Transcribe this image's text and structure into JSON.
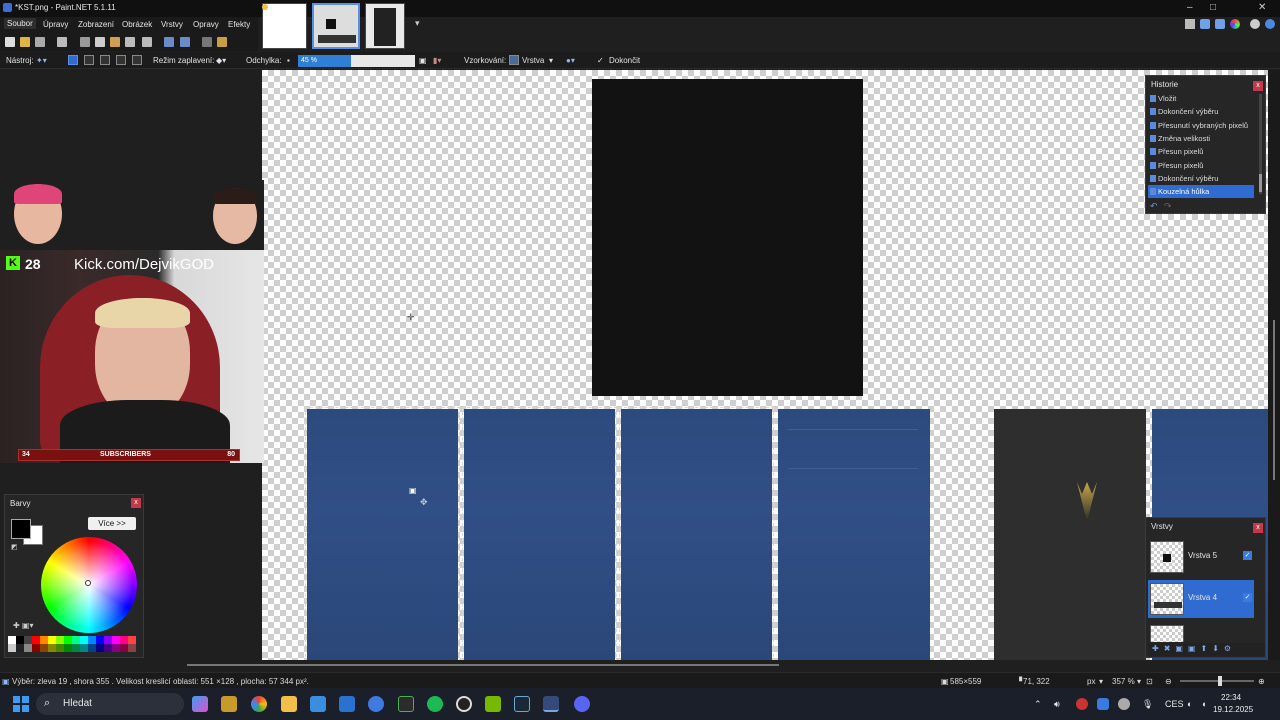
{
  "window": {
    "title": "*KST.png - Paint.NET 5.1.11"
  },
  "menu": [
    "Soubor",
    "Úpravy",
    "Zobrazení",
    "Obrázek",
    "Vrstvy",
    "Opravy",
    "Efekty"
  ],
  "toolbar": {
    "tool_label": "Nástroj:",
    "fill_mode_label": "Režim zaplavení:",
    "tolerance_label": "Odchylka:",
    "tolerance_value": "45 %",
    "tolerance_fraction": 0.45,
    "sampling_label": "Vzorkování:",
    "sampling_value": "Vrstva",
    "finish_label": "Dokončit"
  },
  "stream_overlay": {
    "kick_count": "28",
    "kick_text": "Kick.com/DejvikGOD",
    "subs_left": "34",
    "subs_label": "SUBSCRIBERS",
    "subs_right": "80"
  },
  "colors_panel": {
    "title": "Barvy",
    "more_button": "Více >>"
  },
  "history_panel": {
    "title": "Historie",
    "items": [
      "Vložit",
      "Dokončení výběru",
      "Přesunutí vybraných pixelů",
      "Změna velikosti",
      "Přesun pixelů",
      "Přesun pixelů",
      "Dokončení výběru",
      "Kouzelná hůlka"
    ],
    "selected_index": 7
  },
  "layers_panel": {
    "title": "Vrstvy",
    "layers": [
      {
        "name": "Vrstva 5",
        "visible": true,
        "selected": false
      },
      {
        "name": "Vrstva 4",
        "visible": true,
        "selected": true
      }
    ]
  },
  "status": {
    "selection_info": "Výběr: zleva 19 , shora 355 . Velikost kreslicí oblasti: 551 ×128 , plocha: 57 344 px².",
    "image_size": "585×559",
    "cursor_pos": "71, 322",
    "units": "px",
    "zoom": "357 %"
  },
  "taskbar": {
    "search_placeholder": "Hledat",
    "language": "CES",
    "time": "22:34",
    "date": "19.12.2025"
  },
  "theme": {
    "accent": "#2f6bd0",
    "texture_blue": "#2f4e84",
    "texture_black": "#121212",
    "kick_green": "#53fc18"
  }
}
